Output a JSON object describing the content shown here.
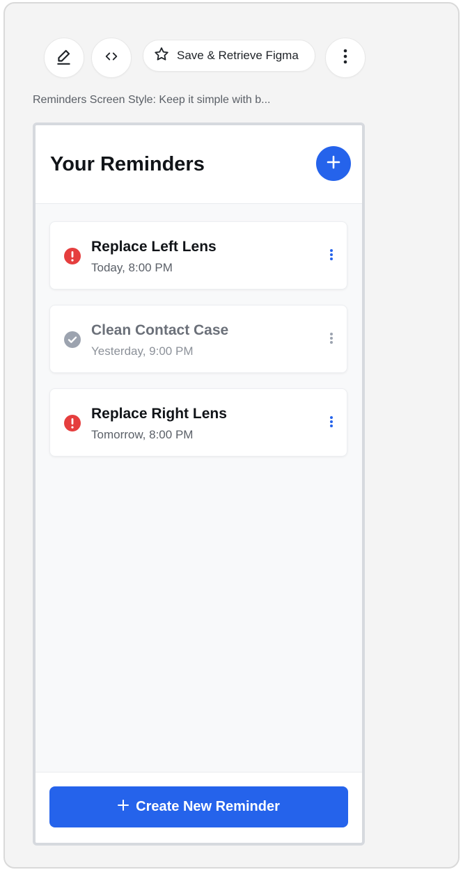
{
  "toolbar": {
    "edit_icon": "pencil-icon",
    "code_icon": "code-icon",
    "star_icon": "star-icon",
    "more_icon": "more-vertical-icon",
    "save_label": "Save & Retrieve Figma"
  },
  "caption": "Reminders Screen Style: Keep it simple with b...",
  "screen": {
    "title": "Your Reminders",
    "add_icon": "plus-icon",
    "reminders": [
      {
        "title": "Replace Left Lens",
        "time": "Today, 8:00 PM",
        "status": "due",
        "status_icon": "alert-icon"
      },
      {
        "title": "Clean Contact Case",
        "time": "Yesterday, 9:00 PM",
        "status": "done",
        "status_icon": "check-circle-icon"
      },
      {
        "title": "Replace Right Lens",
        "time": "Tomorrow, 8:00 PM",
        "status": "due",
        "status_icon": "alert-icon"
      }
    ],
    "create_label": "Create New Reminder"
  },
  "colors": {
    "accent": "#2563eb",
    "alert": "#e53e3e",
    "done": "#9ca3af"
  }
}
